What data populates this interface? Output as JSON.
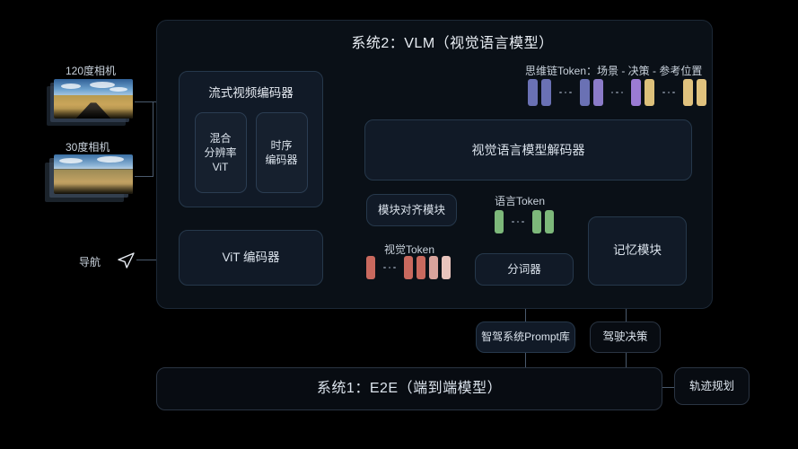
{
  "diagram": {
    "background_color": "#000000",
    "panel_color": "#0a1017",
    "box_color": "#111a27",
    "accent_line_color": "#4a5a6d"
  },
  "system2": {
    "title": "系统2：VLM（视觉语言模型）",
    "stream_encoder": {
      "label": "流式视频编码器",
      "children": [
        {
          "label": "混合\n分辨率\nViT",
          "lines": [
            "混合",
            "分辨率",
            "ViT"
          ]
        },
        {
          "label": "时序\n编码器",
          "lines": [
            "时序",
            "编码器"
          ]
        }
      ]
    },
    "vit_encoder": {
      "label": "ViT 编码器"
    },
    "vlm_decoder": {
      "label": "视觉语言模型解码器"
    },
    "align_module": {
      "label": "模块对齐模块"
    },
    "tokenizer": {
      "label": "分词器"
    },
    "memory_module": {
      "label": "记忆模块"
    },
    "cot": {
      "label": "思维链Token：场景 - 决策 - 参考位置",
      "tokens": [
        {
          "color": "#6a71b4",
          "type": "block"
        },
        {
          "color": "#6a71b4",
          "type": "block"
        },
        {
          "type": "ellipsis"
        },
        {
          "color": "#6a71b4",
          "type": "block"
        },
        {
          "color": "#8b7bc8",
          "type": "block"
        },
        {
          "type": "ellipsis"
        },
        {
          "color": "#9b7bd4",
          "type": "block"
        },
        {
          "color": "#ddc07a",
          "type": "block"
        },
        {
          "type": "ellipsis"
        },
        {
          "color": "#e0c27e",
          "type": "block"
        },
        {
          "color": "#e0c27e",
          "type": "block"
        }
      ]
    },
    "visual_tokens": {
      "label": "视觉Token",
      "tokens": [
        {
          "color": "#c9695e",
          "type": "block"
        },
        {
          "type": "ellipsis"
        },
        {
          "color": "#c9695e",
          "type": "block"
        },
        {
          "color": "#c9695e",
          "type": "block"
        },
        {
          "color": "#d9a39c",
          "type": "block"
        },
        {
          "color": "#e8c4bd",
          "type": "block"
        }
      ]
    },
    "language_tokens": {
      "label": "语言Token",
      "tokens": [
        {
          "color": "#7db87a",
          "type": "block"
        },
        {
          "type": "ellipsis"
        },
        {
          "color": "#7db87a",
          "type": "block"
        },
        {
          "color": "#7db87a",
          "type": "block"
        }
      ]
    }
  },
  "outputs": {
    "prompt_library": {
      "label": "智驾系统Prompt库"
    },
    "driving_decision": {
      "label": "驾驶决策"
    },
    "trajectory_planning": {
      "label": "轨迹规划"
    }
  },
  "system1": {
    "title": "系统1：E2E（端到端模型）"
  },
  "inputs": {
    "camera_120": {
      "label": "120度相机",
      "icon": "camera-thumbnail-icon"
    },
    "camera_30": {
      "label": "30度相机",
      "icon": "camera-thumbnail-icon"
    },
    "navigation": {
      "label": "导航",
      "icon": "navigation-arrow-icon"
    }
  }
}
